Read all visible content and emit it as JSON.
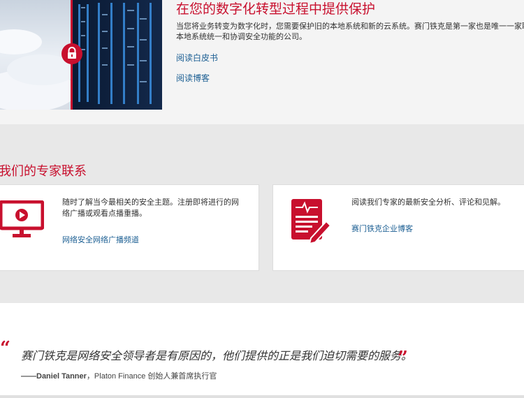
{
  "hero": {
    "title": "在您的数字化转型过程中提供保护",
    "desc_line1": "当您将业务转变为数字化时，您需要保护旧的本地系统和新的云系统。赛门铁克是第一家也是唯一一家联",
    "desc_line2": "本地系统统一和协调安全功能的公司。",
    "link1": "阅读白皮书",
    "link2": "阅读博客",
    "image_icon": "lock-icon"
  },
  "experts": {
    "title": "我们的专家联系",
    "card1": {
      "icon": "monitor-play-icon",
      "text": "随时了解当今最相关的安全主题。注册即将进行的网络广播或观看点播重播。",
      "link": "网络安全网络广播频道"
    },
    "card2": {
      "icon": "document-pen-icon",
      "text": "阅读我们专家的最新安全分析、评论和见解。",
      "link": "赛门铁克企业博客"
    }
  },
  "quote": {
    "open_mark": "“",
    "close_mark": "”",
    "text": "赛门铁克是网络安全领导者是有原因的，他们提供的正是我们迫切需要的服务。",
    "author_dash": "——",
    "author_name": "Daniel Tanner",
    "author_rest": "，Platon Finance 创始人兼首席执行官"
  },
  "colors": {
    "accent": "#c8102e",
    "link": "#1c5f93",
    "bg_gray": "#e8e8e8"
  }
}
